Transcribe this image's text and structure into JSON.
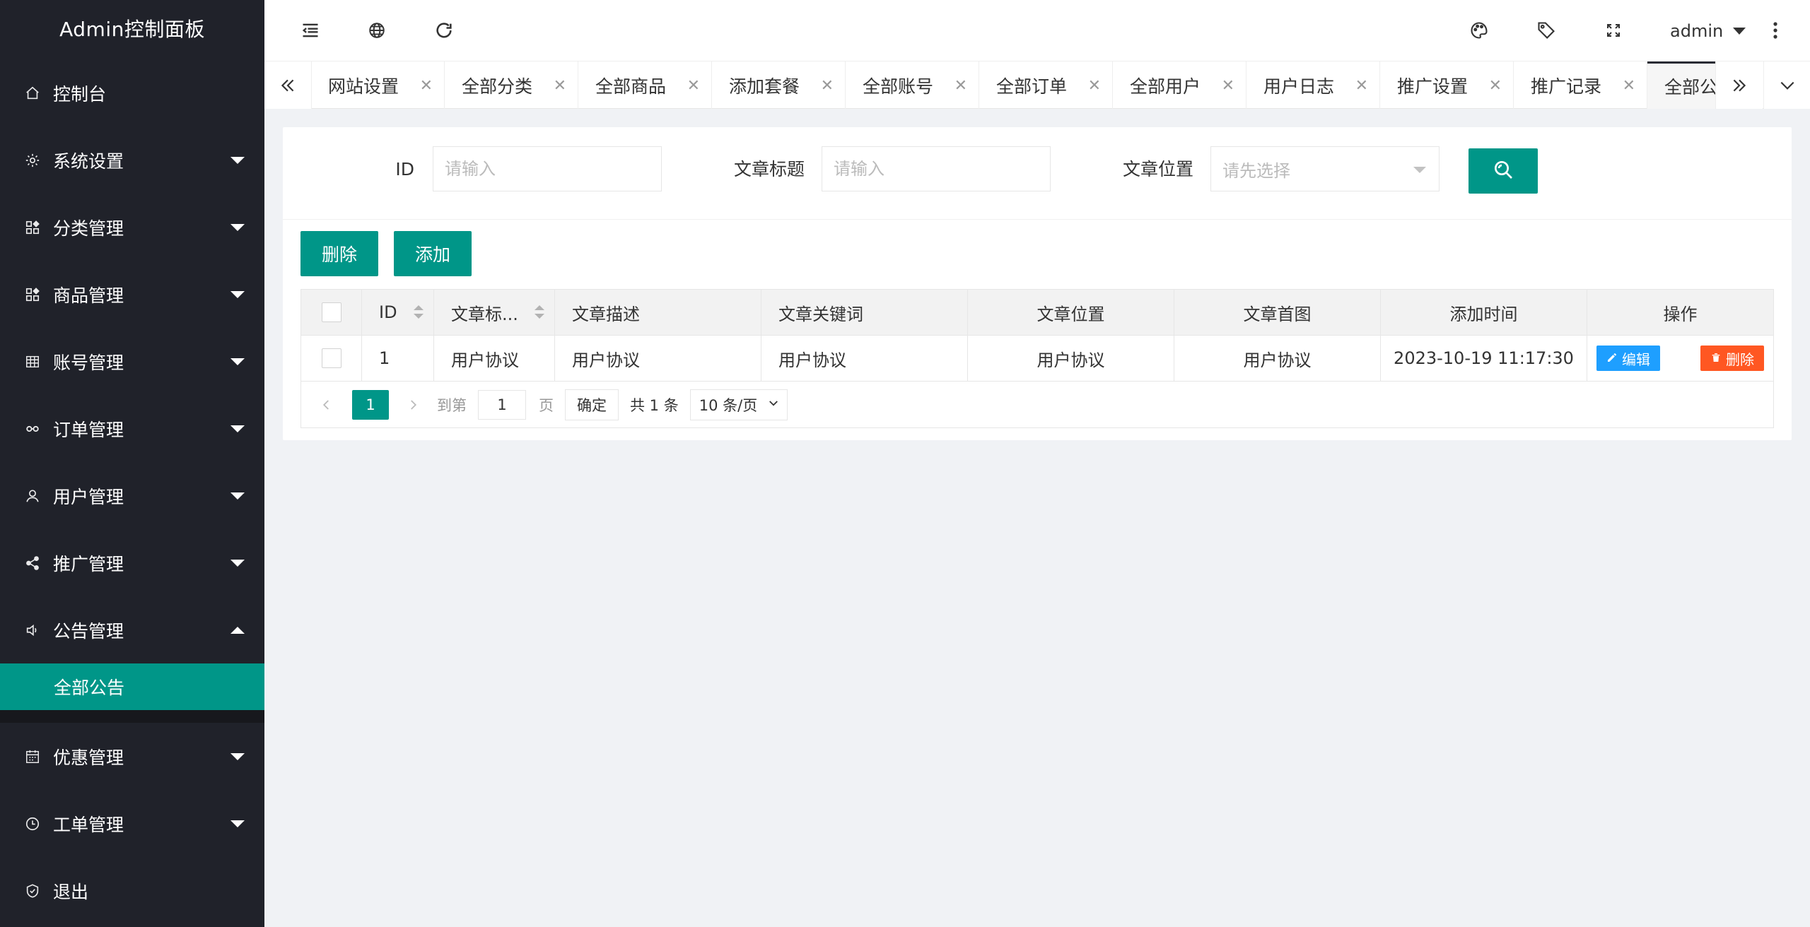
{
  "app": {
    "title": "Admin控制面板"
  },
  "sidebar": {
    "items": [
      {
        "label": "控制台",
        "icon": "home-icon"
      },
      {
        "label": "系统设置",
        "icon": "gear-icon",
        "has_children": true
      },
      {
        "label": "分类管理",
        "icon": "apps-icon",
        "has_children": true
      },
      {
        "label": "商品管理",
        "icon": "apps-icon",
        "has_children": true
      },
      {
        "label": "账号管理",
        "icon": "grid-icon",
        "has_children": true
      },
      {
        "label": "订单管理",
        "icon": "link-icon",
        "has_children": true
      },
      {
        "label": "用户管理",
        "icon": "user-icon",
        "has_children": true
      },
      {
        "label": "推广管理",
        "icon": "share-icon",
        "has_children": true
      },
      {
        "label": "公告管理",
        "icon": "speaker-icon",
        "has_children": true,
        "expanded": true
      },
      {
        "label": "优惠管理",
        "icon": "calendar-icon",
        "has_children": true
      },
      {
        "label": "工单管理",
        "icon": "clock-icon",
        "has_children": true
      },
      {
        "label": "退出",
        "icon": "shield-icon"
      }
    ],
    "active_subitem": "全部公告"
  },
  "header": {
    "left_icons": [
      "indent-icon",
      "globe-icon",
      "refresh-icon"
    ],
    "right_icons": [
      "theme-icon",
      "tag-icon",
      "fullscreen-icon"
    ],
    "user": "admin",
    "more_icon": "more-vertical-icon"
  },
  "tabs": [
    {
      "label": "网站设置"
    },
    {
      "label": "全部分类"
    },
    {
      "label": "全部商品"
    },
    {
      "label": "添加套餐"
    },
    {
      "label": "全部账号"
    },
    {
      "label": "全部订单"
    },
    {
      "label": "全部用户"
    },
    {
      "label": "用户日志"
    },
    {
      "label": "推广设置"
    },
    {
      "label": "推广记录"
    },
    {
      "label": "全部公告",
      "active": true
    }
  ],
  "search": {
    "id_label": "ID",
    "id_placeholder": "请输入",
    "title_label": "文章标题",
    "title_placeholder": "请输入",
    "position_label": "文章位置",
    "position_placeholder": "请先选择"
  },
  "toolbar": {
    "delete_label": "删除",
    "add_label": "添加"
  },
  "table": {
    "columns": [
      "ID",
      "文章标...",
      "文章描述",
      "文章关键词",
      "文章位置",
      "文章首图",
      "添加时间",
      "操作"
    ],
    "rows": [
      {
        "id": "1",
        "title": "用户协议",
        "description": "用户协议",
        "keywords": "用户协议",
        "position": "用户协议",
        "image": "用户协议",
        "created": "2023-10-19 11:17:30"
      }
    ],
    "row_actions": {
      "edit": "编辑",
      "delete": "删除"
    }
  },
  "pagination": {
    "current_page": "1",
    "goto_label": "到第",
    "goto_value": "1",
    "page_unit": "页",
    "confirm_label": "确定",
    "total": "共 1 条",
    "page_size": "10 条/页"
  },
  "colors": {
    "sidebar_bg": "#20222a",
    "accent": "#009688",
    "edit": "#1e9fff",
    "danger": "#ff5722"
  }
}
